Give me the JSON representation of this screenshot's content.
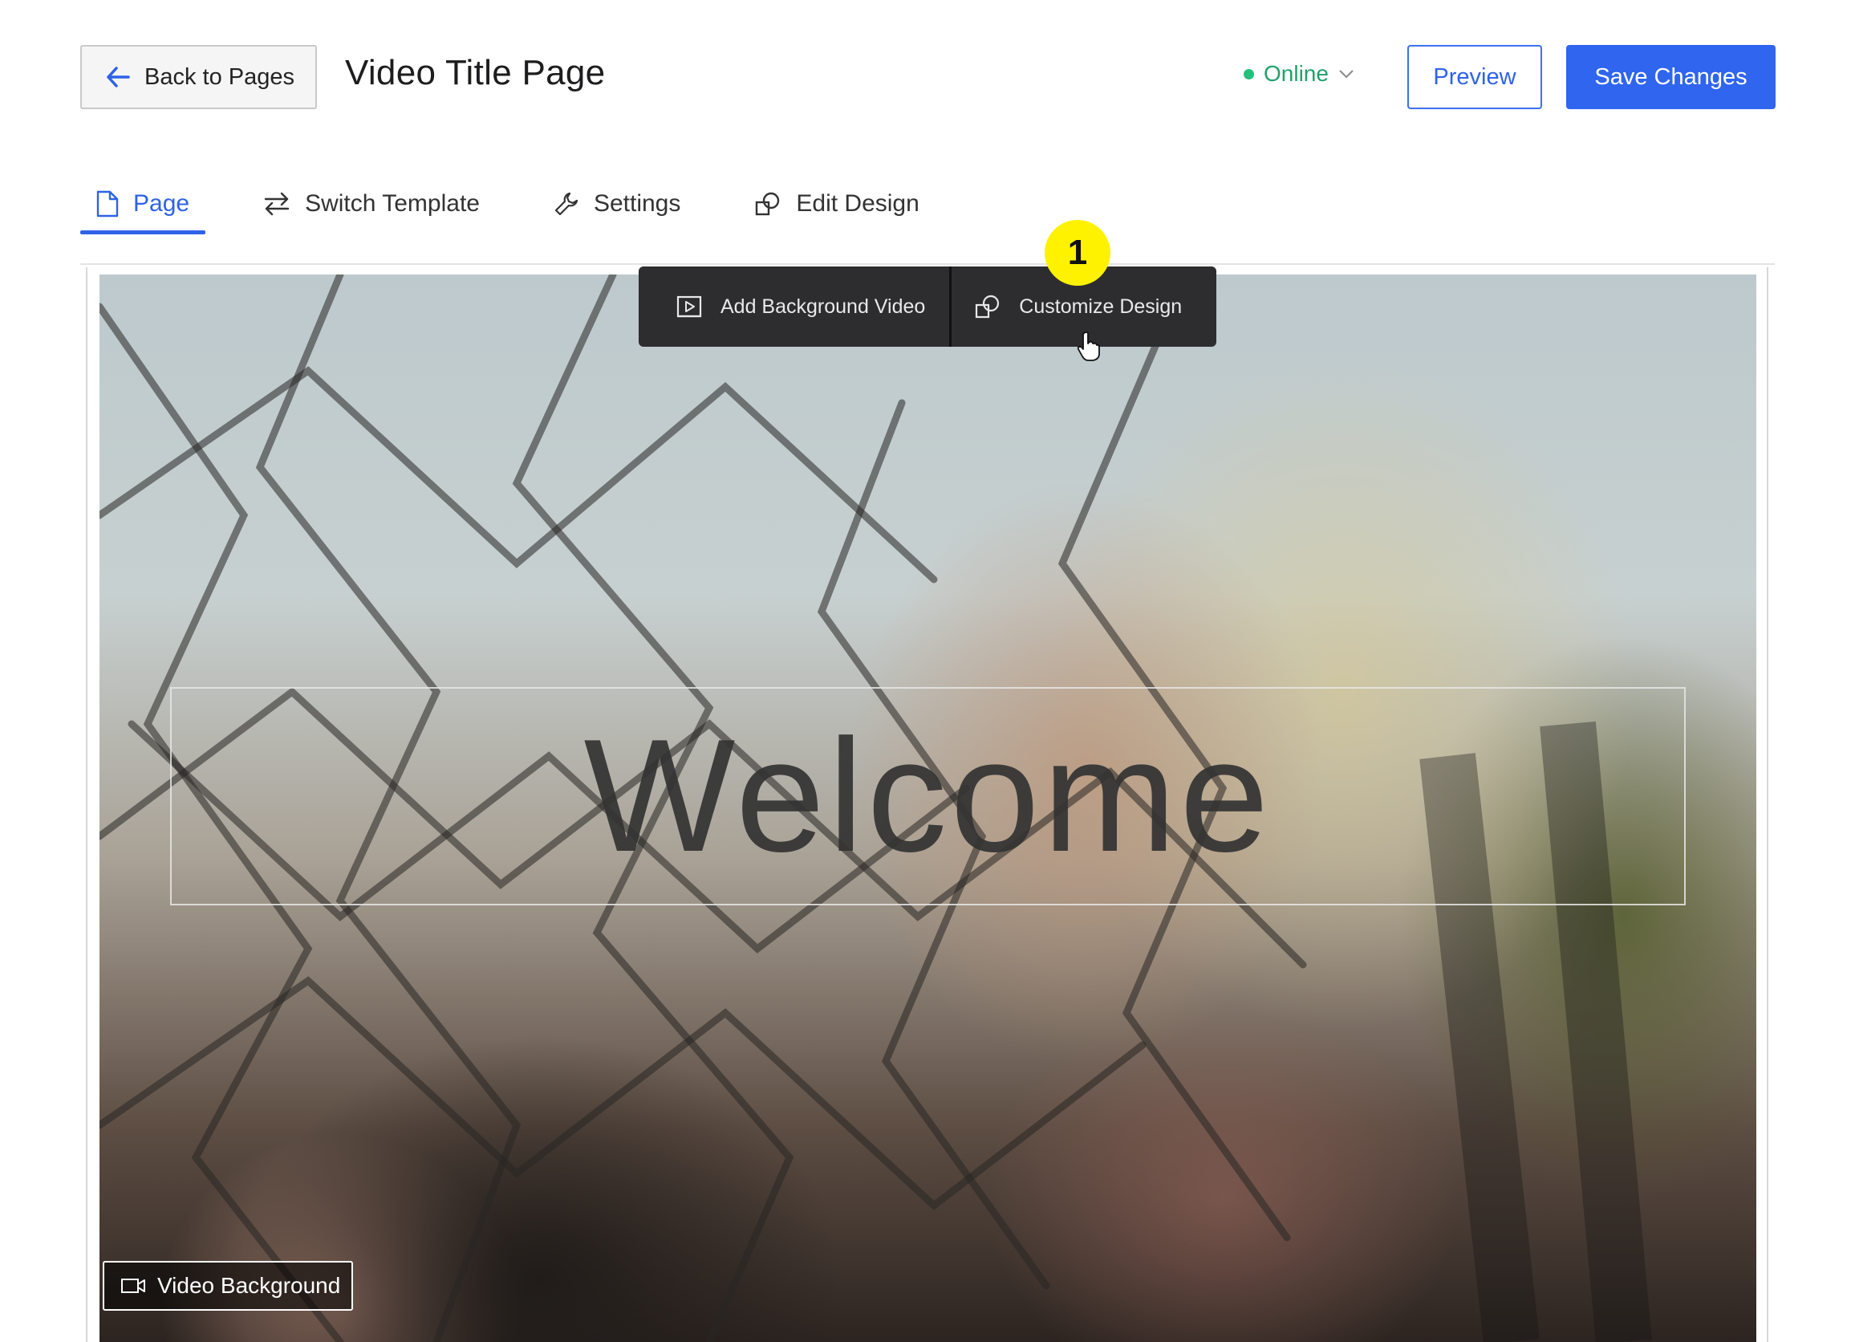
{
  "header": {
    "back_label": "Back to Pages",
    "page_title": "Video Title Page",
    "status_label": "Online",
    "preview_label": "Preview",
    "save_label": "Save Changes"
  },
  "tabs": [
    {
      "label": "Page",
      "icon": "document-icon",
      "active": true
    },
    {
      "label": "Switch Template",
      "icon": "swap-arrows-icon",
      "active": false
    },
    {
      "label": "Settings",
      "icon": "wrench-icon",
      "active": false
    },
    {
      "label": "Edit Design",
      "icon": "design-shapes-icon",
      "active": false
    }
  ],
  "toolbar": {
    "add_video_label": "Add Background Video",
    "customize_label": "Customize Design"
  },
  "step_badge": "1",
  "canvas": {
    "heading": "Welcome",
    "video_background_label": "Video Background"
  },
  "colors": {
    "accent": "#2f65ef",
    "status_green": "#22c07a",
    "badge_yellow": "#fff200",
    "toolbar_bg": "#2d2d30"
  }
}
